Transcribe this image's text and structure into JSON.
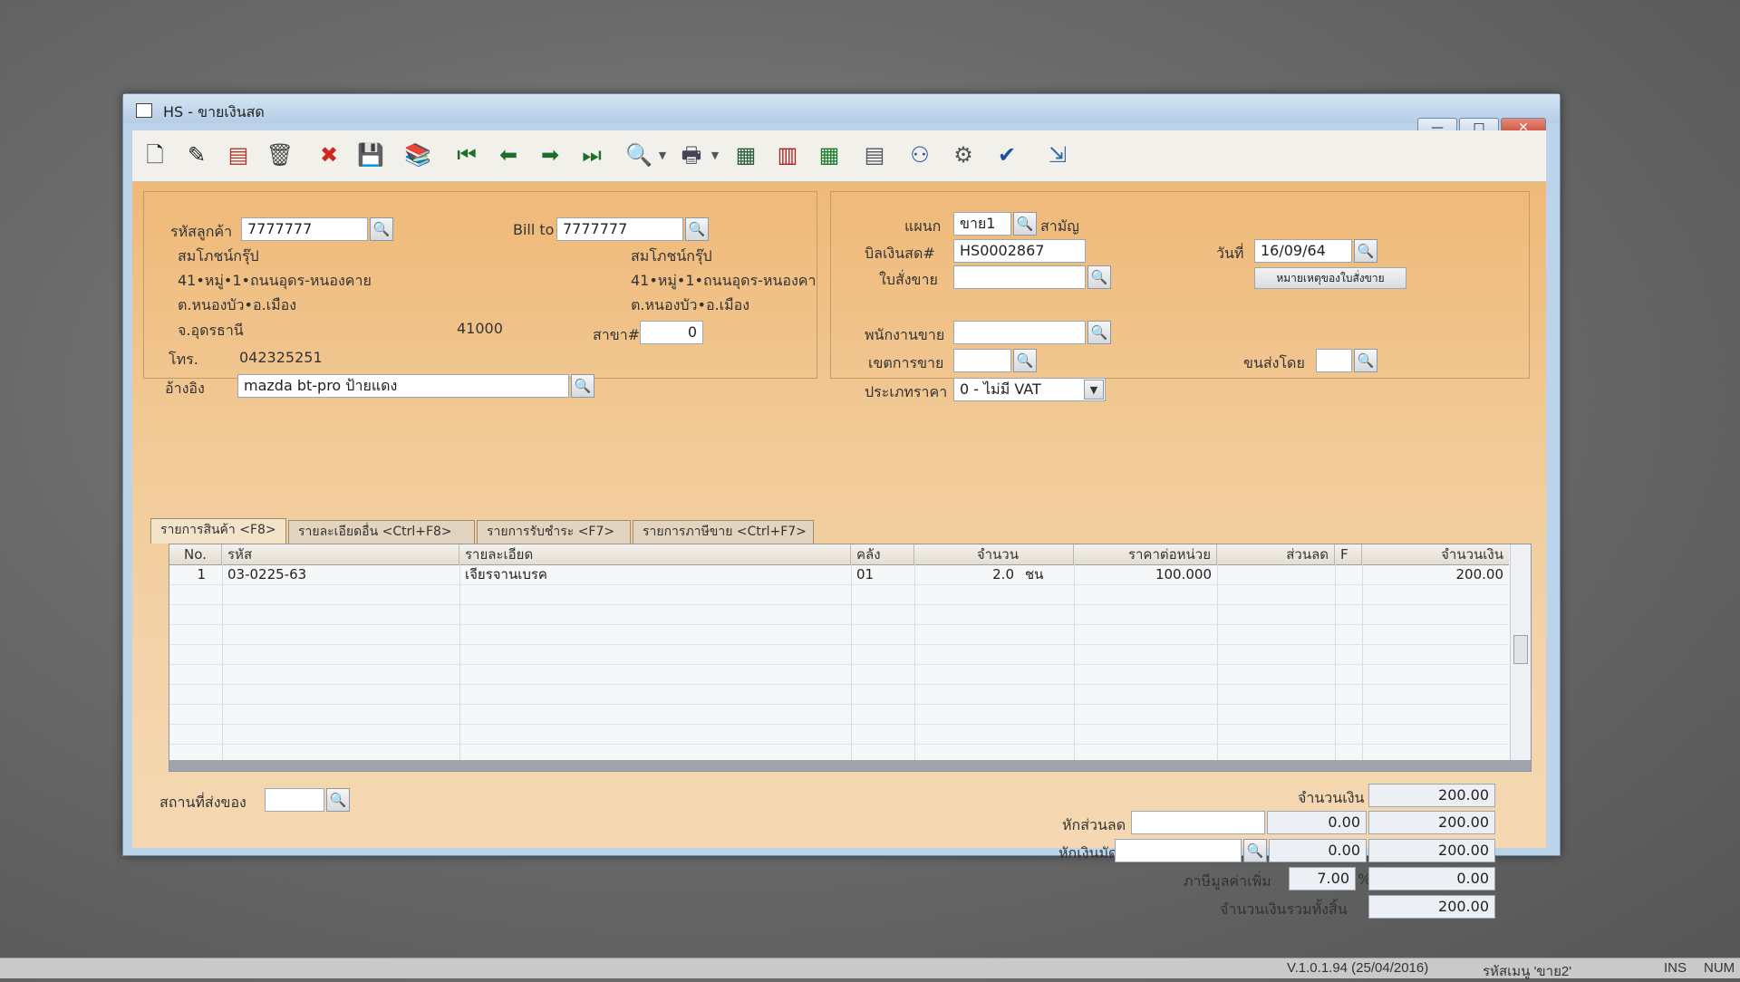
{
  "window": {
    "title": "HS - ขายเงินสด",
    "min": "—",
    "max": "□",
    "close": "✕"
  },
  "customer": {
    "code_label": "รหัสลูกค้า",
    "code": "7777777",
    "bill_to_label": "Bill to",
    "bill_to": "7777777",
    "name": "สมโภชน์กรุ๊ป",
    "address1": "41•หมู่•1•ถนนอุดร-หนองคาย",
    "address2": "ต.หนองบัว•อ.เมือง",
    "province": "จ.อุดรธานี",
    "zip": "41000",
    "bill_name": "สมโภชน์กรุ๊ป",
    "bill_address1": "41•หมู่•1•ถนนอุดร-หนองคา",
    "bill_address2": "ต.หนองบัว•อ.เมือง",
    "phone_label": "โทร.",
    "phone": "042325251",
    "branch_label": "สาขา#",
    "branch": "0",
    "ref_label": "อ้างอิง",
    "ref": "mazda bt-pro  ป้ายแดง"
  },
  "doc": {
    "dept_label": "แผนก",
    "dept": "ขาย1",
    "dept_name": "สามัญ",
    "bill_label": "บิลเงินสด#",
    "bill_no": "HS0002867",
    "date_label": "วันที่",
    "date": "16/09/64",
    "order_label": "ใบสั่งขาย",
    "order": "",
    "order_note_button": "หมายเหตุของใบสั่งขาย",
    "salesman_label": "พนักงานขาย",
    "salesman": "",
    "zone_label": "เขตการขาย",
    "zone": "",
    "ship_by_label": "ขนส่งโดย",
    "ship_by": "",
    "price_type_label": "ประเภทราคา",
    "price_type": "0 - ไม่มี VAT"
  },
  "tabs": [
    {
      "label": "รายการสินค้า <F8>"
    },
    {
      "label": "รายละเอียดอื่น <Ctrl+F8>"
    },
    {
      "label": "รายการรับชำระ <F7>"
    },
    {
      "label": "รายการภาษีขาย <Ctrl+F7>"
    }
  ],
  "grid": {
    "headers": [
      "No.",
      "รหัส",
      "รายละเอียด",
      "คลัง",
      "จำนวน",
      "ราคาต่อหน่วย",
      "ส่วนลด",
      "F",
      "จำนวนเงิน"
    ],
    "rows": [
      {
        "no": "1",
        "code": "03-0225-63",
        "desc": "เจียรจานเบรค",
        "wh": "01",
        "qty": "2.0",
        "unit": "ชน",
        "price": "100.000",
        "disc": "",
        "f": "",
        "amount": "200.00"
      }
    ]
  },
  "footer": {
    "ship_to_label": "สถานที่ส่งของ",
    "ship_to": "",
    "amount_label": "จำนวนเงิน",
    "amount": "200.00",
    "discount_label": "หักส่วนลด",
    "discount_input": "",
    "discount_val": "0.00",
    "after_discount": "200.00",
    "deposit_label": "หักเงินมัดจำ",
    "deposit_input": "",
    "deposit_val": "0.00",
    "after_deposit": "200.00",
    "vat_label": "ภาษีมูลค่าเพิ่ม",
    "vat_rate": "7.00",
    "vat_pct": "%",
    "vat_amount": "0.00",
    "total_label": "จำนวนเงินรวมทั้งสิ้น",
    "total": "200.00"
  },
  "statusbar": {
    "version": "V.1.0.1.94 (25/04/2016)",
    "menu_code": "รหัสเมนู 'ขาย2'",
    "ins": "INS",
    "num": "NUM"
  }
}
